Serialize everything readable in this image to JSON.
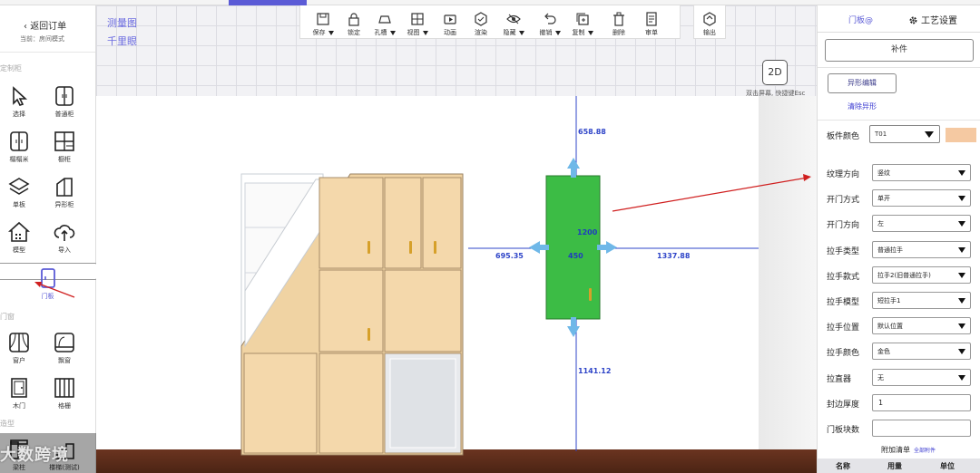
{
  "left": {
    "back_label": "返回订单",
    "mode_label": "当前：房间模式",
    "section_custom": "定制柜",
    "section_doors": "门窗",
    "section_other": "造型",
    "tools": [
      {
        "label": "选择",
        "icon": "cursor-icon"
      },
      {
        "label": "普通柜",
        "icon": "cabinet-icon"
      },
      {
        "label": "榻榻米",
        "icon": "tatami-icon"
      },
      {
        "label": "橱柜",
        "icon": "kitchen-cabinet-icon"
      },
      {
        "label": "单板",
        "icon": "layers-icon"
      },
      {
        "label": "异形柜",
        "icon": "irregular-cabinet-icon"
      },
      {
        "label": "模型",
        "icon": "house-icon"
      },
      {
        "label": "导入",
        "icon": "upload-icon"
      },
      {
        "label": "门板",
        "icon": "door-panel-icon"
      },
      {
        "label": "窗户",
        "icon": "window-icon"
      },
      {
        "label": "飘窗",
        "icon": "bay-window-icon"
      },
      {
        "label": "木门",
        "icon": "wood-door-icon"
      },
      {
        "label": "格栅",
        "icon": "grille-icon"
      },
      {
        "label": "梁柱",
        "icon": "pillar-icon"
      },
      {
        "label": "楼梯(测试)",
        "icon": "stairs-icon"
      }
    ]
  },
  "canvas": {
    "measure_label": "测量图",
    "eye_label": "千里眼",
    "view_2d": "2D",
    "hint_2d": "双击屏幕, 快捷键Esc",
    "dims": {
      "top": "658.88",
      "left": "695.35",
      "center_h": "1200",
      "center_w": "450",
      "right": "1337.88",
      "bottom": "1141.12"
    }
  },
  "toolbar": {
    "items": [
      {
        "label": "保存",
        "icon": "save-icon",
        "dropdown": true
      },
      {
        "label": "锁定",
        "icon": "lock-icon",
        "dropdown": false
      },
      {
        "label": "孔槽",
        "icon": "slot-icon",
        "dropdown": true
      },
      {
        "label": "视图",
        "icon": "view-grid-icon",
        "dropdown": true
      },
      {
        "label": "动画",
        "icon": "video-icon",
        "dropdown": false
      },
      {
        "label": "渲染",
        "icon": "render-icon",
        "dropdown": false
      },
      {
        "label": "隐藏",
        "icon": "eye-icon",
        "dropdown": true
      },
      {
        "label": "撤销",
        "icon": "undo-icon",
        "dropdown": true
      },
      {
        "label": "复制",
        "icon": "copy-icon",
        "dropdown": true
      },
      {
        "label": "删除",
        "icon": "trash-icon",
        "dropdown": false
      },
      {
        "label": "审单",
        "icon": "review-icon",
        "dropdown": false
      }
    ],
    "export_label": "输出"
  },
  "right": {
    "tab_door": "门板@",
    "tab_craft": "工艺设置",
    "bupian": "补件",
    "yixing_edit": "异形编辑",
    "clear_yixing": "清除异形",
    "board_color_label": "板件颜色",
    "board_color_value": "T01",
    "swatch_color": "#f5c9a2",
    "fields": [
      {
        "label": "纹理方向",
        "value": "竖纹",
        "type": "select"
      },
      {
        "label": "开门方式",
        "value": "单开",
        "type": "select"
      },
      {
        "label": "开门方向",
        "value": "左",
        "type": "select"
      },
      {
        "label": "拉手类型",
        "value": "普通拉手",
        "type": "select"
      },
      {
        "label": "拉手款式",
        "value": "拉手2(旧普通拉手)",
        "type": "select"
      },
      {
        "label": "拉手模型",
        "value": "短拉手1",
        "type": "select"
      },
      {
        "label": "拉手位置",
        "value": "默认位置",
        "type": "select"
      },
      {
        "label": "拉手颜色",
        "value": "金色",
        "type": "select"
      },
      {
        "label": "拉直器",
        "value": "无",
        "type": "select"
      },
      {
        "label": "封边厚度",
        "value": "1",
        "type": "input"
      },
      {
        "label": "门板块数",
        "value": "",
        "type": "input"
      }
    ],
    "fujia_label": "附加清单",
    "fujia_all": "全部附件",
    "table_headers": [
      "名称",
      "用量",
      "单位"
    ]
  },
  "watermark": "大数跨境",
  "colors": {
    "accent": "#5b5bd6",
    "door_green": "#3cbc45",
    "wood": "#f0d3a3",
    "dim_blue": "#2f45c8",
    "arrow_red": "#d02020"
  }
}
